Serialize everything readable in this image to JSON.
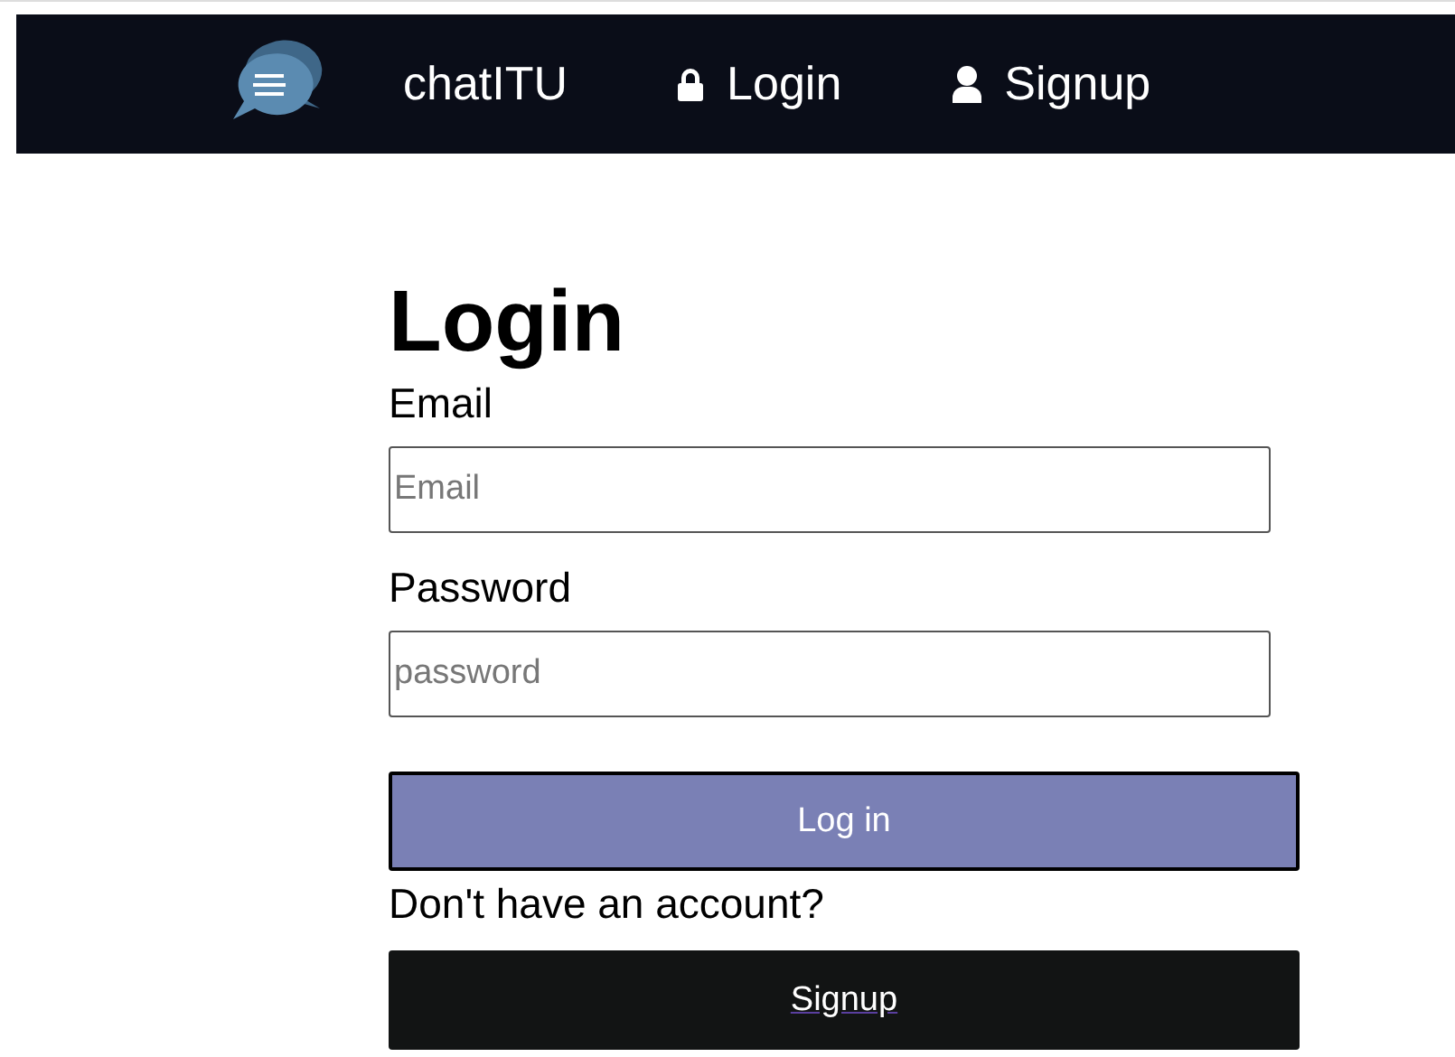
{
  "navbar": {
    "brand": "chatITU",
    "links": [
      {
        "label": "Login",
        "kind": "lock"
      },
      {
        "label": "Signup",
        "kind": "user"
      }
    ]
  },
  "form": {
    "title": "Login",
    "fields": [
      {
        "label": "Email",
        "placeholder": "Email"
      },
      {
        "label": "Password",
        "placeholder": "password"
      }
    ],
    "submit": "Log in",
    "prompt": "Don't have an account?",
    "signup": "Signup"
  }
}
